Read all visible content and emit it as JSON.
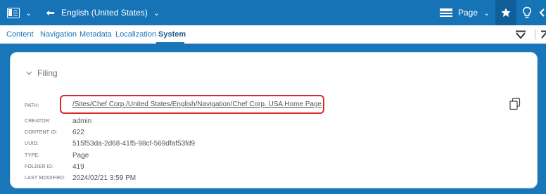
{
  "topbar": {
    "site_icon": "site-switcher-icon",
    "language": "English (United States)",
    "page_selector": "Page",
    "star_icon": "star-icon",
    "bulb_icon": "lightbulb-icon",
    "colors": {
      "bar": "#1673b6",
      "active_button": "#0f5e99"
    }
  },
  "tabs": [
    {
      "label": "Content"
    },
    {
      "label": "Navigation"
    },
    {
      "label": "Metadata"
    },
    {
      "label": "Localization"
    },
    {
      "label": "System"
    }
  ],
  "active_tab": "System",
  "filing": {
    "title": "Filing",
    "path": {
      "label": "PATH:",
      "value": "/Sites/Chef Corp./United States/English/Navigation/Chef Corp. USA Home Page"
    },
    "creator": {
      "label": "CREATOR:",
      "value": "admin"
    },
    "content_id": {
      "label": "CONTENT ID:",
      "value": "622"
    },
    "uuid": {
      "label": "UUID:",
      "value": "515f53da-2d68-41f5-98cf-569dfaf53fd9"
    },
    "type": {
      "label": "TYPE:",
      "value": "Page"
    },
    "folder_id": {
      "label": "FOLDER ID:",
      "value": "419"
    },
    "last_modified": {
      "label": "LAST MODIFIED:",
      "value": "2024/02/21 3:59 PM"
    }
  },
  "colors": {
    "background": "#1976b8",
    "highlight": "#d72b2b",
    "link": "#1b76b9"
  }
}
